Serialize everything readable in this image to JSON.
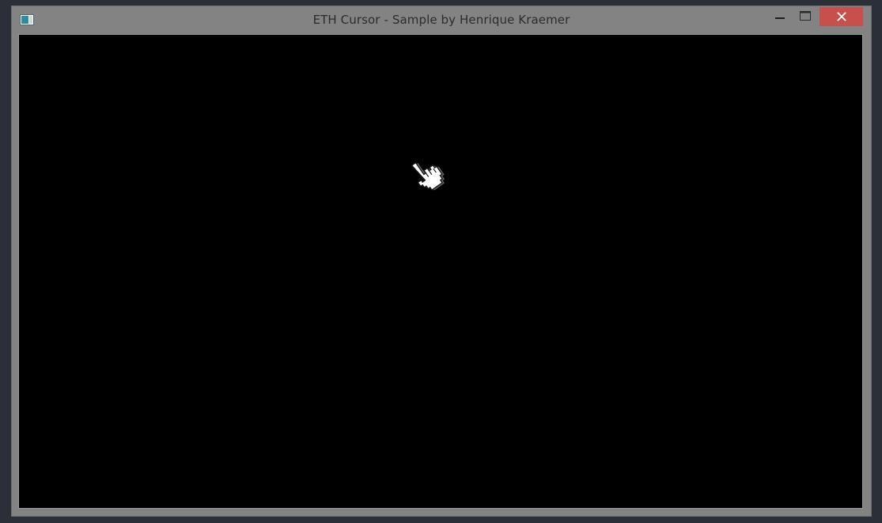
{
  "window": {
    "title": "ETH Cursor - Sample by Henrique Kraemer",
    "close_color": "#c7504c"
  },
  "icons": {
    "app": "window-icon",
    "minimize": "minimize-icon",
    "maximize": "maximize-icon",
    "close": "close-icon",
    "cursor": "hand-pointer-cursor-icon"
  },
  "canvas": {
    "background": "#000000"
  }
}
